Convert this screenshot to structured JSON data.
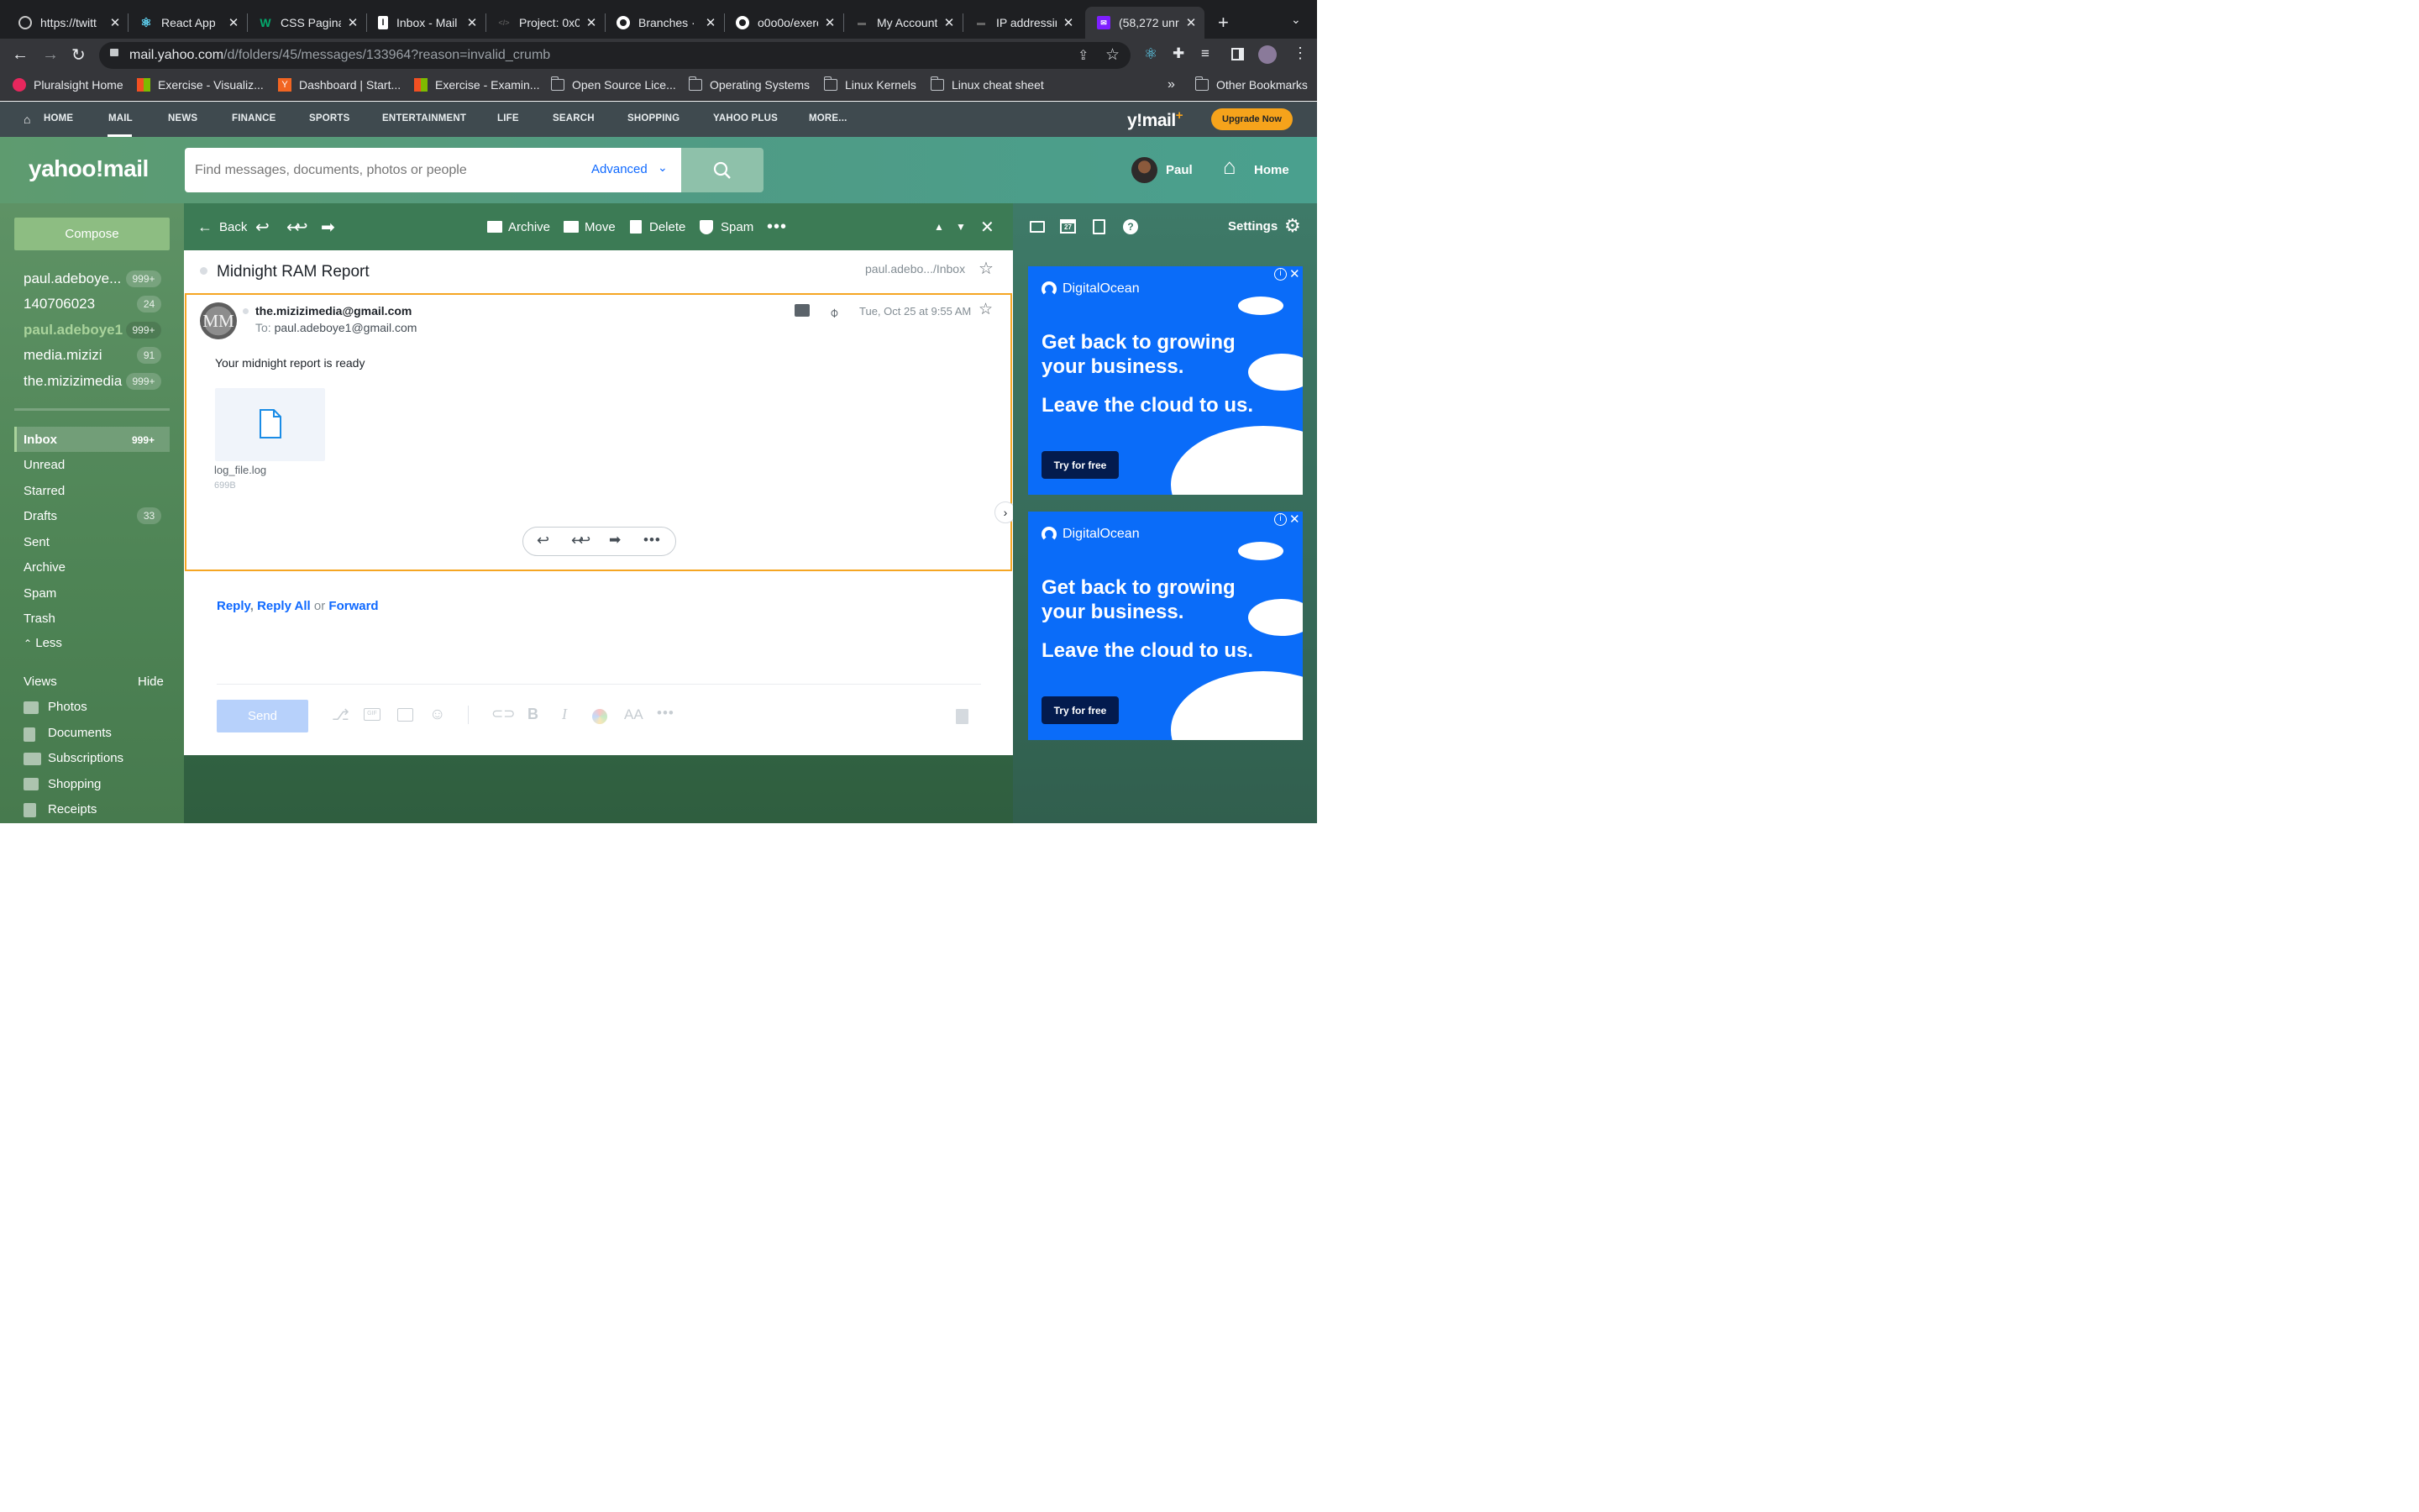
{
  "browser": {
    "tabs": [
      {
        "label": "https://twitt",
        "icon": "globe-icon"
      },
      {
        "label": "React App",
        "icon": "react-icon"
      },
      {
        "label": "CSS Paginat",
        "icon": "w3-icon"
      },
      {
        "label": "Inbox - Mail",
        "icon": "inbox-icon"
      },
      {
        "label": "Project: 0x0",
        "icon": "project-icon"
      },
      {
        "label": "Branches · G",
        "icon": "github-icon"
      },
      {
        "label": "o0o0o/exerc",
        "icon": "github-icon"
      },
      {
        "label": "My Account",
        "icon": "account-icon"
      },
      {
        "label": "IP addressin",
        "icon": "ip-icon"
      },
      {
        "label": "(58,272 unr",
        "icon": "yahoo-mail-icon"
      }
    ],
    "new_tab": "+",
    "url_host": "mail.yahoo.com",
    "url_path": "/d/folders/45/messages/133964?reason=invalid_crumb",
    "bookmarks": [
      {
        "label": "Pluralsight Home"
      },
      {
        "label": "Exercise - Visualiz..."
      },
      {
        "label": "Dashboard | Start..."
      },
      {
        "label": "Exercise - Examin..."
      },
      {
        "label": "Open Source Lice..."
      },
      {
        "label": "Operating Systems"
      },
      {
        "label": "Linux Kernels"
      },
      {
        "label": "Linux cheat sheet"
      }
    ],
    "bookmarks_overflow": "»",
    "other_bookmarks": "Other Bookmarks"
  },
  "ynav": {
    "items": [
      "HOME",
      "MAIL",
      "NEWS",
      "FINANCE",
      "SPORTS",
      "ENTERTAINMENT",
      "LIFE",
      "SEARCH",
      "SHOPPING",
      "YAHOO PLUS",
      "MORE..."
    ],
    "brand": "y!mail",
    "brand_plus": "+",
    "upgrade": "Upgrade Now"
  },
  "header": {
    "logo": "yahoo!mail",
    "search_placeholder": "Find messages, documents, photos or people",
    "advanced": "Advanced",
    "user": "Paul",
    "home": "Home"
  },
  "sidebar": {
    "compose": "Compose",
    "accounts": [
      {
        "name": "paul.adeboye...",
        "count": "999+"
      },
      {
        "name": "140706023",
        "count": "24"
      },
      {
        "name": "paul.adeboye1",
        "count": "999+"
      },
      {
        "name": "media.mizizi",
        "count": "91"
      },
      {
        "name": "the.mizizimedia",
        "count": "999+"
      }
    ],
    "folders": [
      {
        "name": "Inbox",
        "count": "999+"
      },
      {
        "name": "Unread",
        "count": ""
      },
      {
        "name": "Starred",
        "count": ""
      },
      {
        "name": "Drafts",
        "count": "33"
      },
      {
        "name": "Sent",
        "count": ""
      },
      {
        "name": "Archive",
        "count": ""
      },
      {
        "name": "Spam",
        "count": ""
      },
      {
        "name": "Trash",
        "count": ""
      }
    ],
    "less": "Less",
    "views_label": "Views",
    "views_hide": "Hide",
    "views": [
      {
        "name": "Photos"
      },
      {
        "name": "Documents"
      },
      {
        "name": "Subscriptions"
      },
      {
        "name": "Shopping"
      },
      {
        "name": "Receipts"
      }
    ]
  },
  "toolbar": {
    "back": "Back",
    "archive": "Archive",
    "move": "Move",
    "delete": "Delete",
    "spam": "Spam"
  },
  "message": {
    "subject": "Midnight RAM Report",
    "folder_path": "paul.adebo.../Inbox",
    "sender_initials": "MM",
    "from": "the.mizizimedia@gmail.com",
    "to_label": "To:",
    "to": "paul.adeboye1@gmail.com",
    "date": "Tue, Oct 25 at 9:55 AM",
    "body": "Your midnight report is ready",
    "attachment_name": "log_file.log",
    "attachment_size": "699B"
  },
  "reply": {
    "reply": "Reply",
    "comma": ",",
    "reply_all": "Reply All",
    "or": "or",
    "forward": "Forward",
    "send": "Send"
  },
  "rightpane": {
    "calendar_day": "27",
    "settings": "Settings"
  },
  "ads": [
    {
      "brand": "DigitalOcean",
      "headline": "Get back to growing your business.",
      "sub": "Leave the cloud to us.",
      "cta": "Try for free"
    },
    {
      "brand": "DigitalOcean",
      "headline": "Get back to growing your business.",
      "sub": "Leave the cloud to us.",
      "cta": "Try for free"
    }
  ],
  "colors": {
    "accent": "#0f69ff",
    "upgrade": "#f6a31b",
    "sidebar": "#55885c",
    "ad_bg": "#0a6cf9"
  }
}
